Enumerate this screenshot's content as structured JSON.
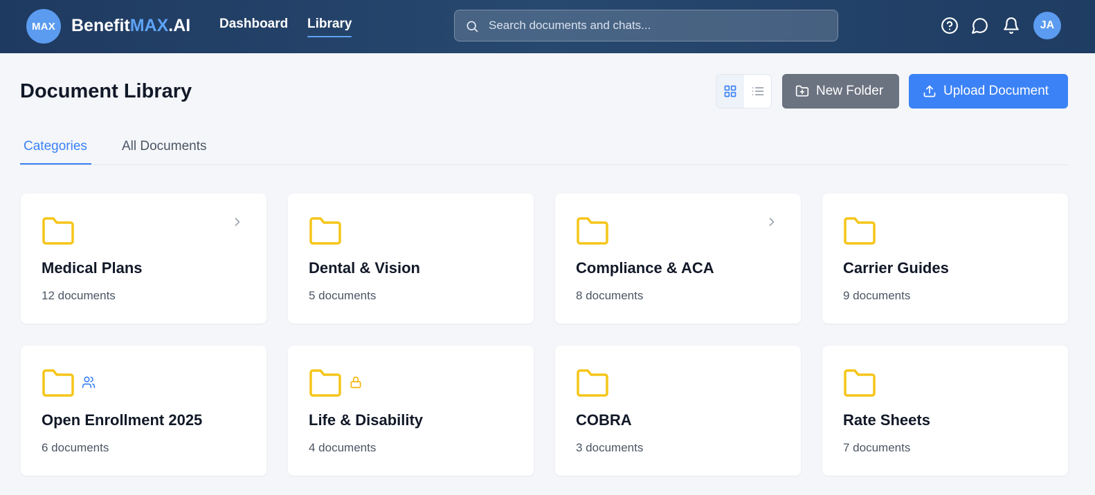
{
  "header": {
    "logo_badge": "MAX",
    "brand_prefix": "Benefit",
    "brand_accent": "MAX",
    "brand_suffix": ".AI",
    "nav": [
      {
        "label": "Dashboard",
        "active": false
      },
      {
        "label": "Library",
        "active": true
      }
    ],
    "search_placeholder": "Search documents and chats...",
    "icons": [
      "help-circle-icon",
      "chat-bubble-icon",
      "bell-icon"
    ],
    "avatar_initials": "JA"
  },
  "page": {
    "title": "Document Library",
    "view_modes": [
      "grid",
      "list"
    ],
    "active_view": "grid",
    "new_folder_label": "New Folder",
    "upload_label": "Upload Document"
  },
  "tabs": [
    {
      "label": "Categories",
      "active": true
    },
    {
      "label": "All Documents",
      "active": false
    }
  ],
  "folders": [
    {
      "name": "Medical Plans",
      "count": "12 documents",
      "badge": null,
      "chevron": true
    },
    {
      "name": "Dental & Vision",
      "count": "5 documents",
      "badge": null,
      "chevron": false
    },
    {
      "name": "Compliance & ACA",
      "count": "8 documents",
      "badge": null,
      "chevron": true
    },
    {
      "name": "Carrier Guides",
      "count": "9 documents",
      "badge": null,
      "chevron": false
    },
    {
      "name": "Open Enrollment 2025",
      "count": "6 documents",
      "badge": "users-icon",
      "chevron": false
    },
    {
      "name": "Life & Disability",
      "count": "4 documents",
      "badge": "lock-icon",
      "chevron": false
    },
    {
      "name": "COBRA",
      "count": "3 documents",
      "badge": null,
      "chevron": false
    },
    {
      "name": "Rate Sheets",
      "count": "7 documents",
      "badge": null,
      "chevron": false
    }
  ],
  "colors": {
    "header_bg": "#1f3a60",
    "accent": "#3b82f6",
    "folder": "#f5c518",
    "lock_badge": "#f5b50a",
    "users_badge": "#3b82f6",
    "secondary_button": "#6b7280"
  }
}
